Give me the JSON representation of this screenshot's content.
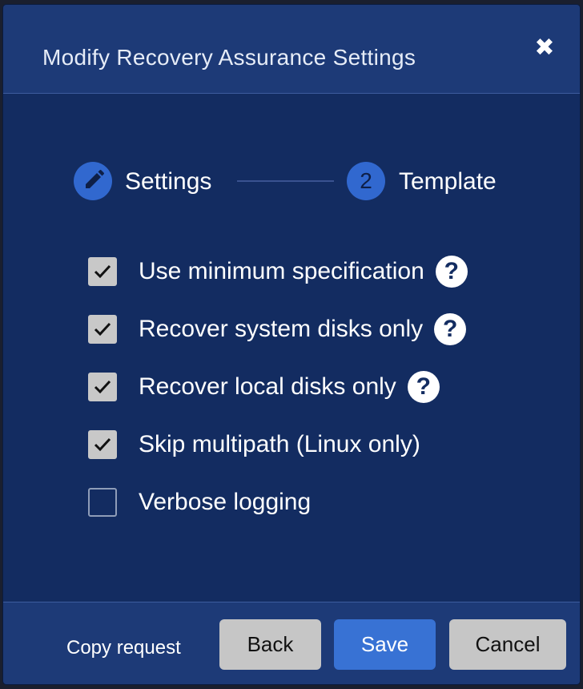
{
  "dialog": {
    "title": "Modify Recovery Assurance Settings",
    "close_icon": "close-icon"
  },
  "stepper": {
    "steps": [
      {
        "label": "Settings",
        "icon": "pencil-icon",
        "number": ""
      },
      {
        "label": "Template",
        "icon": "",
        "number": "2"
      }
    ]
  },
  "options": [
    {
      "label": "Use minimum specification",
      "checked": true,
      "help": "?"
    },
    {
      "label": "Recover system disks only",
      "checked": true,
      "help": "?"
    },
    {
      "label": "Recover local disks only",
      "checked": true,
      "help": "?"
    },
    {
      "label": "Skip multipath (Linux only)",
      "checked": true,
      "help": ""
    },
    {
      "label": "Verbose logging",
      "checked": false,
      "help": ""
    }
  ],
  "footer": {
    "copy_request": "Copy request",
    "back": "Back",
    "save": "Save",
    "cancel": "Cancel"
  },
  "colors": {
    "background": "#132c61",
    "header": "#1d3a77",
    "accent": "#3168cf",
    "save_button": "#3872d4"
  }
}
